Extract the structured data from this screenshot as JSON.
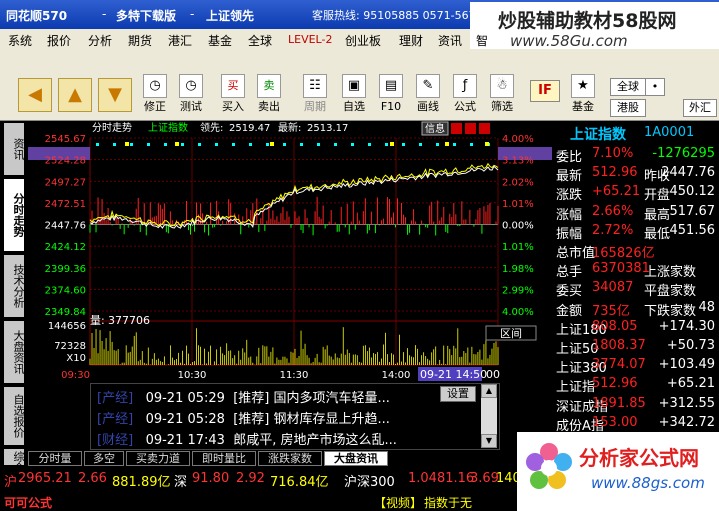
{
  "window": {
    "app_name": "同花顺570",
    "sep": "-",
    "menu1": "多特下载版",
    "menu2": "上证领先",
    "hotline": "客服热线: 95105885 0571-5676888"
  },
  "watermark_top": {
    "line1": "炒股辅助教材58股网",
    "line2": "www.58Gu.com"
  },
  "watermark_bottom": {
    "line1": "分析家公式网",
    "line2": "www.88gs.com"
  },
  "menubar": [
    "系统",
    "报价",
    "分析",
    "期货",
    "港汇",
    "基金",
    "全球",
    "LEVEL-2",
    "创业板",
    "理财",
    "资讯",
    "智"
  ],
  "toolbar": {
    "buttons": [
      {
        "label": "修正",
        "icon": "clock-icon"
      },
      {
        "label": "测试",
        "icon": "clock-icon"
      },
      {
        "label": "买入",
        "icon": "buy-icon"
      },
      {
        "label": "卖出",
        "icon": "sell-icon"
      },
      {
        "label": "周期",
        "icon": "period-icon"
      },
      {
        "label": "自选",
        "icon": "folder-icon"
      },
      {
        "label": "F10",
        "icon": "doc-icon"
      },
      {
        "label": "画线",
        "icon": "pencil-icon"
      },
      {
        "label": "公式",
        "icon": "formula-icon"
      },
      {
        "label": "筛选",
        "icon": "filter-icon"
      },
      {
        "label": "基金",
        "icon": "fund-icon"
      }
    ],
    "right_buttons": [
      "全球",
      "港股",
      "外汇"
    ],
    "if_label": "IF"
  },
  "sidetabs": [
    "资讯",
    "分时走势",
    "技术分析",
    "大盘资讯",
    "自选报价",
    "综合"
  ],
  "chart": {
    "header": {
      "mode": "分时走势",
      "index": "上证指数",
      "lead_label": "领先:",
      "lead_value": "2519.47",
      "latest_label": "最新:",
      "latest_value": "2513.17",
      "info_btn": "信息"
    },
    "price_ticks": [
      "2545.67",
      "2524.28",
      "2497.27",
      "2472.51",
      "2447.76",
      "2424.12",
      "2399.36",
      "2374.60",
      "2349.84"
    ],
    "pct_ticks": [
      "4.00%",
      "3.13%",
      "2.02%",
      "1.01%",
      "0.00%",
      "1.01%",
      "1.98%",
      "2.99%",
      "4.00%"
    ],
    "volume_label": "量:",
    "volume_value": "377706",
    "vol_ticks": [
      "144656",
      "72328",
      "X10"
    ],
    "time_ticks": [
      "09:30",
      "10:30",
      "11:30",
      "14:00"
    ],
    "time_highlight": "09-21 14:50",
    "time_end": "00",
    "interval_btn": "区间",
    "series": [
      {
        "name": "上证指数",
        "color": "#ffffff"
      },
      {
        "name": "领先",
        "color": "#ffff00"
      }
    ],
    "chart_data": {
      "type": "line",
      "ylim": [
        2349.84,
        2545.67
      ],
      "y_ref": 2447.76,
      "sessions": [
        "09:30",
        "10:30",
        "11:30",
        "14:00",
        "15:00"
      ]
    }
  },
  "right": {
    "title": "上证指数",
    "code": "1A0001",
    "rows": [
      {
        "k": "委比",
        "v": "7.10%",
        "k2": "",
        "v2": "-1276295"
      },
      {
        "k": "最新",
        "v": "512.96",
        "k2": "昨收",
        "v2": "2447.76"
      },
      {
        "k": "涨跌",
        "v": "+65.21",
        "k2": "开盘",
        "v2": "450.12"
      },
      {
        "k": "涨幅",
        "v": "2.66%",
        "k2": "最高",
        "v2": "517.67"
      },
      {
        "k": "振幅",
        "v": "2.72%",
        "k2": "最低",
        "v2": "451.56"
      },
      {
        "k": "总市值",
        "v": "165826亿",
        "k2": "",
        "v2": ""
      },
      {
        "k": "总手",
        "v": "6370381",
        "k2": "上涨家数",
        "v2": ""
      },
      {
        "k": "委买",
        "v": "34087",
        "k2": "平盘家数",
        "v2": ""
      },
      {
        "k": "金额",
        "v": "735亿",
        "k2": "下跌家数",
        "v2": "48"
      },
      {
        "k": "上证180",
        "v": "808.05",
        "k2": "",
        "v2": "+174.30"
      },
      {
        "k": "上证50",
        "v": "1808.37",
        "k2": "",
        "v2": "+50.73"
      },
      {
        "k": "上证380",
        "v": "3774.07",
        "k2": "",
        "v2": "+103.49"
      },
      {
        "k": "上证指",
        "v": "512.96",
        "k2": "",
        "v2": "+65.21"
      },
      {
        "k": "深证成指",
        "v": "1891.85",
        "k2": "",
        "v2": "+312.55"
      },
      {
        "k": "成份A指",
        "v": "153.00",
        "k2": "",
        "v2": "+342.72"
      },
      {
        "k": "成份B指",
        "v": "825.02",
        "k2": "",
        "v2": "+54.26"
      }
    ]
  },
  "news": {
    "items": [
      {
        "cat": "[产经]",
        "time": "09-21 05:29",
        "tag": "[推荐]",
        "text": "国内多项汽车轻量..."
      },
      {
        "cat": "[产经]",
        "time": "09-21 05:28",
        "tag": "[推荐]",
        "text": "钢材库存显上升趋..."
      },
      {
        "cat": "[财经]",
        "time": "09-21 17:43",
        "tag": "",
        "text": "郎咸平, 房地产市场这么乱..."
      }
    ],
    "settings_btn": "设置"
  },
  "bottom_tabs": [
    "分时量",
    "多空",
    "买卖力道",
    "即时量比",
    "涨跌家数",
    "大盘资讯"
  ],
  "ticker": [
    {
      "t": "沪",
      "c": "#ff3333"
    },
    {
      "t": "2965.21",
      "c": "#ff3333"
    },
    {
      "t": "2.66",
      "c": "#ff3333"
    },
    {
      "t": "881.89亿",
      "c": "#ffff00"
    },
    {
      "t": "深",
      "c": "#fff"
    },
    {
      "t": "91.80",
      "c": "#ff3333"
    },
    {
      "t": "2.92",
      "c": "#ff3333"
    },
    {
      "t": "716.84亿",
      "c": "#ffff00"
    },
    {
      "t": "沪深300",
      "c": "#fff"
    },
    {
      "t": "1.0481.16",
      "c": "#ff3333"
    },
    {
      "t": "3.69",
      "c": "#ff3333"
    },
    {
      "t": "1404",
      "c": "#ffff00"
    }
  ],
  "status": {
    "left": "可可公式",
    "video": "【视频】",
    "news": "指数于无"
  },
  "colors": {
    "up": "#ff2020",
    "down": "#00ff00",
    "accent": "#ffff00",
    "index_line": "#ffffff",
    "lead_line": "#ffff00"
  }
}
